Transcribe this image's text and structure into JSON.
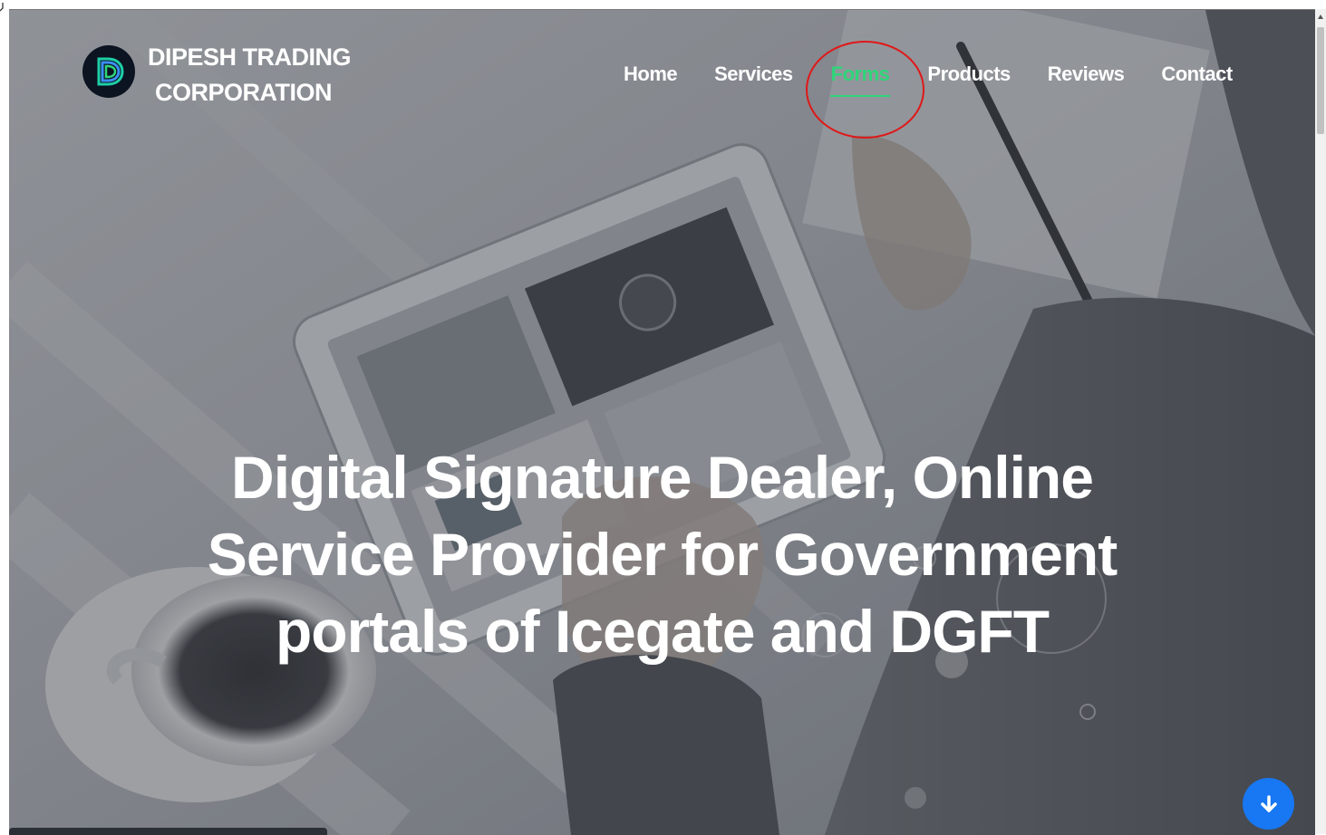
{
  "brand": {
    "line1": "DIPESH TRADING",
    "line2": "CORPORATION",
    "logo_icon": "d-logo-icon"
  },
  "nav": {
    "items": [
      {
        "label": "Home"
      },
      {
        "label": "Services"
      },
      {
        "label": "Forms"
      },
      {
        "label": "Products"
      },
      {
        "label": "Reviews"
      },
      {
        "label": "Contact"
      }
    ],
    "active": "Forms"
  },
  "hero": {
    "line1": "Digital Signature Dealer, Online",
    "line2": "Service Provider for Government",
    "line3": "portals of Icegate and DGFT"
  },
  "scroll_button": {
    "icon": "arrow-down-icon"
  },
  "colors": {
    "accent": "#2fd57a",
    "button": "#1877f2",
    "annotation": "#e01818",
    "text": "#ffffff"
  }
}
